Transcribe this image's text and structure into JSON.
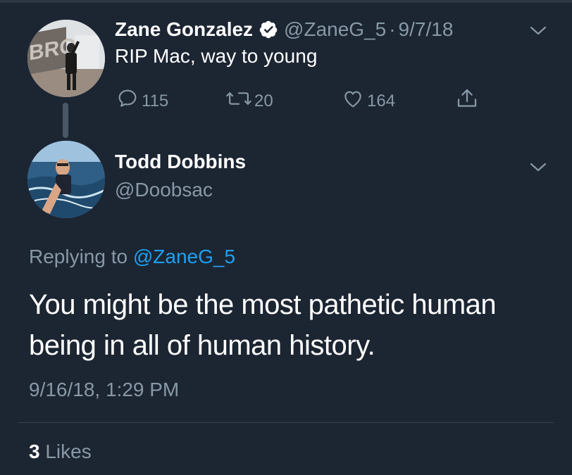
{
  "parent_tweet": {
    "author_name": "Zane Gonzalez",
    "handle": "@ZaneG_5",
    "separator": "·",
    "date": "9/7/18",
    "text": "RIP Mac, way to young",
    "verified": true,
    "reply_count": "115",
    "retweet_count": "20",
    "like_count": "164",
    "avatar_sign_text": "BROWNS"
  },
  "reply_tweet": {
    "author_name": "Todd Dobbins",
    "handle": "@Doobsac",
    "replying_prefix": "Replying to",
    "replying_handle": "@ZaneG_5",
    "text": "You might be the most pathetic human being in all of human history.",
    "timestamp": "9/16/18, 1:29 PM",
    "likes_count": "3",
    "likes_label": "Likes"
  },
  "colors": {
    "background": "#1c2532",
    "text": "#ffffff",
    "muted": "#8899a6",
    "link": "#1da1f2",
    "divider": "#38444d"
  },
  "icons": [
    "verified-badge-icon",
    "chevron-down-icon",
    "reply-icon",
    "retweet-icon",
    "like-icon",
    "share-icon"
  ]
}
